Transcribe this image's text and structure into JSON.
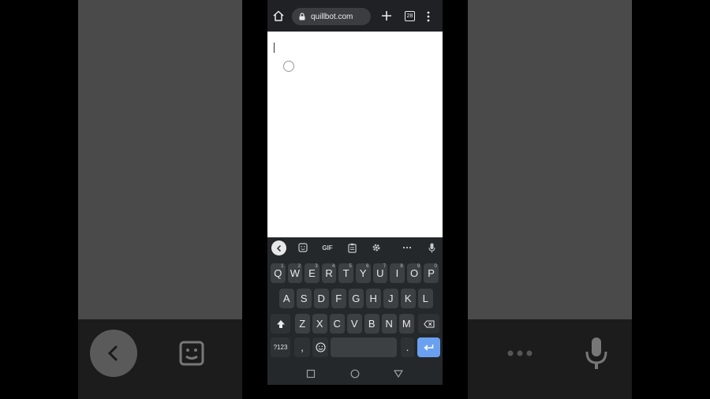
{
  "browser": {
    "url": "quillbot.com",
    "tab_count": "28"
  },
  "keyboard": {
    "toolbar": {
      "gif_label": "GIF"
    },
    "rows": [
      [
        {
          "label": "Q",
          "sup": "1"
        },
        {
          "label": "W",
          "sup": "2"
        },
        {
          "label": "E",
          "sup": "3"
        },
        {
          "label": "R",
          "sup": "4"
        },
        {
          "label": "T",
          "sup": "5"
        },
        {
          "label": "Y",
          "sup": "6"
        },
        {
          "label": "U",
          "sup": "7"
        },
        {
          "label": "I",
          "sup": "8"
        },
        {
          "label": "O",
          "sup": "9"
        },
        {
          "label": "P",
          "sup": "0"
        }
      ],
      [
        {
          "label": "A"
        },
        {
          "label": "S"
        },
        {
          "label": "D"
        },
        {
          "label": "F"
        },
        {
          "label": "G"
        },
        {
          "label": "H"
        },
        {
          "label": "J"
        },
        {
          "label": "K"
        },
        {
          "label": "L"
        }
      ],
      [
        {
          "label": "Z"
        },
        {
          "label": "X"
        },
        {
          "label": "C"
        },
        {
          "label": "V"
        },
        {
          "label": "B"
        },
        {
          "label": "N"
        },
        {
          "label": "M"
        }
      ]
    ],
    "bottom": {
      "symbols_label": "?123",
      "comma_label": ",",
      "period_label": "."
    }
  },
  "colors": {
    "accent_enter": "#6aa0f0",
    "keyboard_bg": "#25282b",
    "key_bg": "#3c4043"
  }
}
